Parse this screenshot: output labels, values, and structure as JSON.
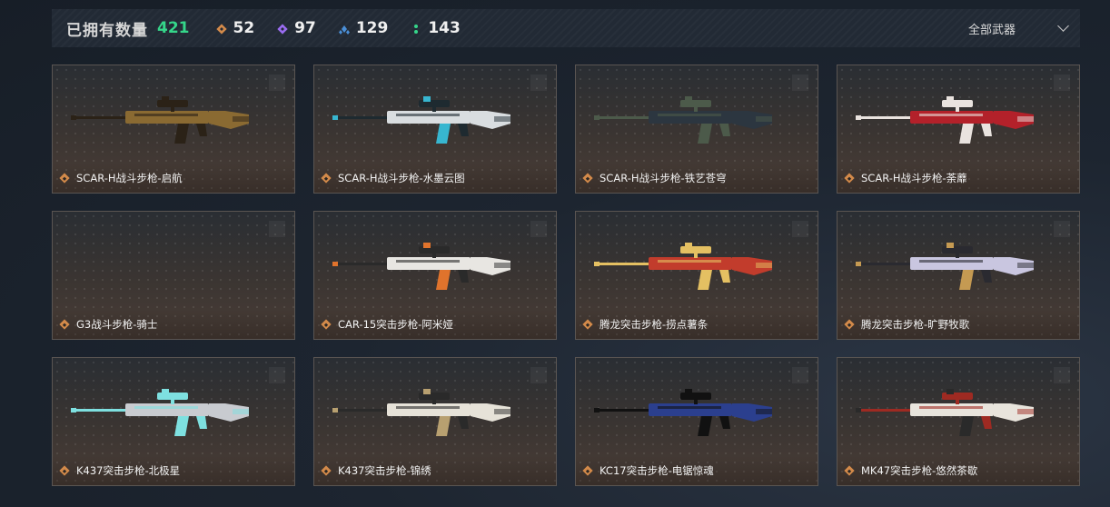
{
  "header": {
    "owned_label": "已拥有数量",
    "owned_count": "421",
    "stats": [
      {
        "icon": "orange-diamond-icon",
        "color": "#d38a4a",
        "value": "52"
      },
      {
        "icon": "purple-diamond-icon",
        "color": "#9a6cf0",
        "value": "97"
      },
      {
        "icon": "blue-cluster-icon",
        "color": "#4a8fd8",
        "value": "129"
      },
      {
        "icon": "green-dots-icon",
        "color": "#35d68a",
        "value": "143"
      }
    ],
    "filter_label": "全部武器"
  },
  "weapons": [
    {
      "name": "SCAR-H战斗步枪-启航",
      "scheme": "gold"
    },
    {
      "name": "SCAR-H战斗步枪-水墨云图",
      "scheme": "teal"
    },
    {
      "name": "SCAR-H战斗步枪-铁艺苍穹",
      "scheme": "dark"
    },
    {
      "name": "SCAR-H战斗步枪-荼蘼",
      "scheme": "red"
    },
    {
      "name": "G3战斗步枪-骑士",
      "scheme": "none"
    },
    {
      "name": "CAR-15突击步枪-阿米娅",
      "scheme": "white-orange"
    },
    {
      "name": "腾龙突击步枪-捞点薯条",
      "scheme": "red-gold"
    },
    {
      "name": "腾龙突击步枪-旷野牧歌",
      "scheme": "lavender"
    },
    {
      "name": "K437突击步枪-北极星",
      "scheme": "silver"
    },
    {
      "name": "K437突击步枪-锦绣",
      "scheme": "white-gold"
    },
    {
      "name": "KC17突击步枪-电锯惊魂",
      "scheme": "blue"
    },
    {
      "name": "MK47突击步枪-悠然茶歇",
      "scheme": "white-red"
    }
  ],
  "colors": {
    "gold": [
      "#8a6a32",
      "#2b2217"
    ],
    "teal": [
      "#d9dde0",
      "#1e2a30",
      "#37b6d0"
    ],
    "dark": [
      "#2c3640",
      "#4c5a4a"
    ],
    "red": [
      "#b3212a",
      "#e9e3df"
    ],
    "white-orange": [
      "#e8e6e2",
      "#2a2a2a",
      "#e0732c"
    ],
    "red-gold": [
      "#c23c2c",
      "#e4c062"
    ],
    "lavender": [
      "#c9c6e0",
      "#2a2a30",
      "#c59a52"
    ],
    "silver": [
      "#c8cbd0",
      "#7ee0e0"
    ],
    "white-gold": [
      "#e6e2d8",
      "#2a2a2a",
      "#b8a070"
    ],
    "blue": [
      "#2b3f8e",
      "#111"
    ],
    "white-red": [
      "#e8e4dc",
      "#9e2a22",
      "#2a2a2a"
    ]
  }
}
